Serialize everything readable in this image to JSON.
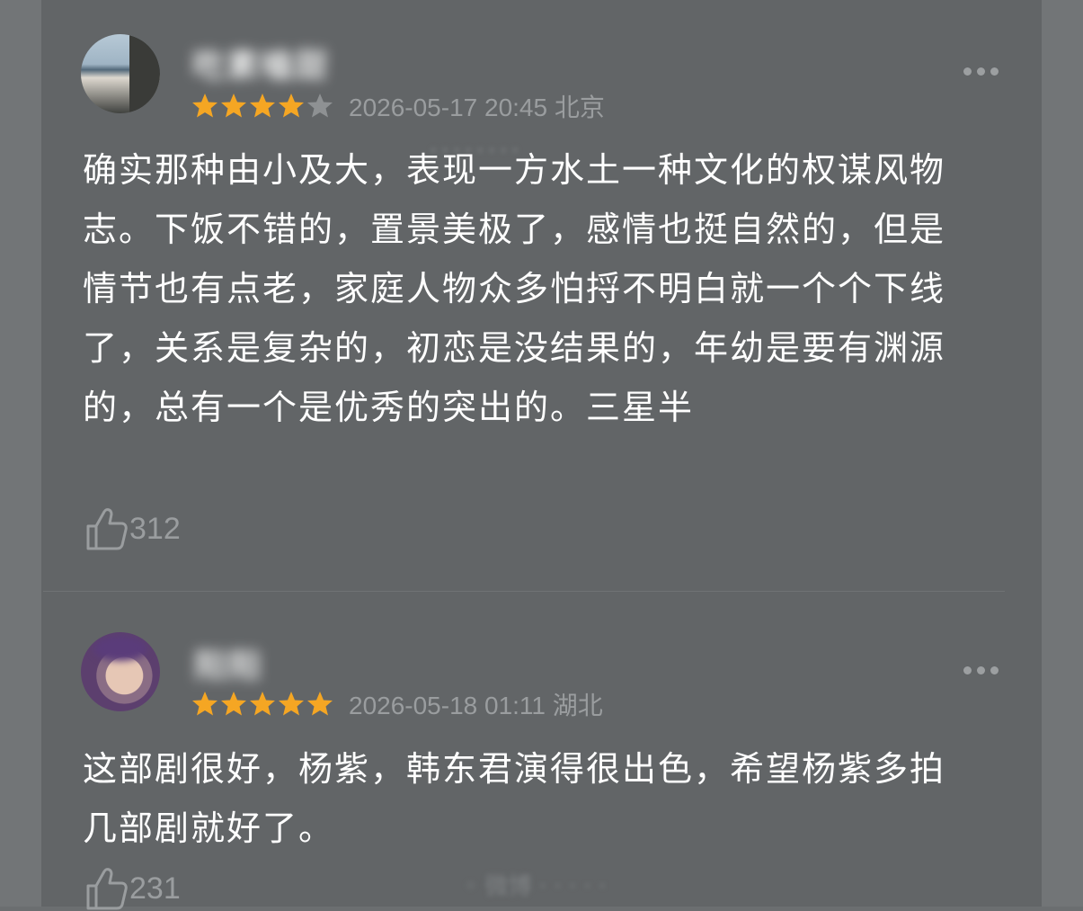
{
  "comments": [
    {
      "username": "吃素嗑甜",
      "username_tail": "†",
      "rating": 4,
      "max_rating": 5,
      "date": "2026-05-17 20:45",
      "location": "北京",
      "body": "确实那种由小及大，表现一方水土一种文化的权谋风物志。下饭不错的，置景美极了，感情也挺自然的，但是情节也有点老，家庭人物众多怕捋不明白就一个个下线了，关系是复杂的，初恋是没结果的，年幼是要有渊源的，总有一个是优秀的突出的。三星半",
      "likes": "312",
      "more_icon": "more-dots-icon",
      "like_icon": "thumb-up-icon"
    },
    {
      "username": "阳阳",
      "rating": 5,
      "max_rating": 5,
      "date": "2026-05-18 01:11",
      "location": "湖北",
      "body": "这部剧很好，杨紫，韩东君演得很出色，希望杨紫多拍几部剧就好了。",
      "likes": "231",
      "more_icon": "more-dots-icon",
      "like_icon": "thumb-up-icon"
    }
  ],
  "colors": {
    "background": "#626567",
    "star_filled": "#f5a623",
    "star_empty": "#8e9193",
    "text": "#ffffff",
    "meta": "#9a9d9f"
  }
}
